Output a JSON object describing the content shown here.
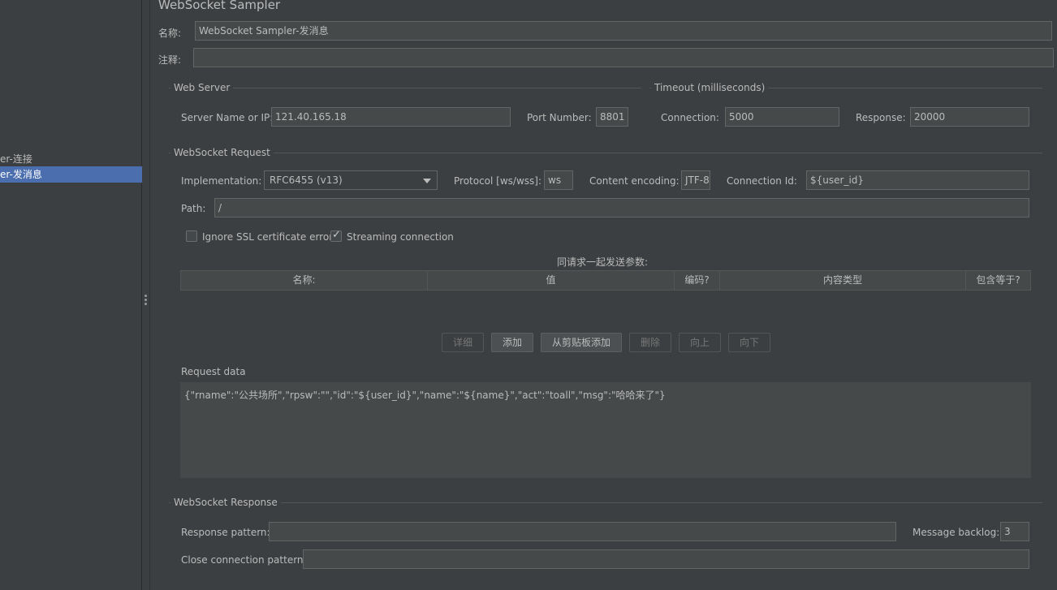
{
  "tree": {
    "items": [
      {
        "label": "er-连接",
        "selected": false
      },
      {
        "label": "er-发消息",
        "selected": true
      }
    ]
  },
  "title": "WebSocket Sampler",
  "name_label": "名称:",
  "name_value": "WebSocket Sampler-发消息",
  "comment_label": "注释:",
  "comment_value": "",
  "web_server": {
    "group_title": "Web Server",
    "server_label": "Server Name or IP:",
    "server_value": "121.40.165.18",
    "port_label": "Port Number:",
    "port_value": "8801"
  },
  "timeout": {
    "group_title": "Timeout (milliseconds)",
    "connection_label": "Connection:",
    "connection_value": "5000",
    "response_label": "Response:",
    "response_value": "20000"
  },
  "request": {
    "group_title": "WebSocket Request",
    "implementation_label": "Implementation:",
    "implementation_value": "RFC6455 (v13)",
    "protocol_label": "Protocol [ws/wss]:",
    "protocol_value": "ws",
    "encoding_label": "Content encoding:",
    "encoding_value": "JTF-8",
    "connid_label": "Connection Id:",
    "connid_value": "${user_id}",
    "path_label": "Path:",
    "path_value": "/",
    "ignore_ssl_label": "Ignore SSL certificate errors",
    "ignore_ssl_checked": false,
    "streaming_label": "Streaming connection",
    "streaming_checked": true,
    "params_title": "同请求一起发送参数:",
    "columns": [
      "名称:",
      "值",
      "编码?",
      "内容类型",
      "包含等于?"
    ],
    "buttons": {
      "detail": "详细",
      "add": "添加",
      "add_clipboard": "从剪贴板添加",
      "delete": "删除",
      "up": "向上",
      "down": "向下"
    },
    "data_label": "Request data",
    "data_value": "{\"rname\":\"公共场所\",\"rpsw\":\"\",\"id\":\"${user_id}\",\"name\":\"${name}\",\"act\":\"toall\",\"msg\":\"哈哈来了\"}"
  },
  "response": {
    "group_title": "WebSocket Response",
    "pattern_label": "Response pattern:",
    "pattern_value": "",
    "backlog_label": "Message backlog:",
    "backlog_value": "3",
    "close_label": "Close connection pattern:",
    "close_value": ""
  }
}
